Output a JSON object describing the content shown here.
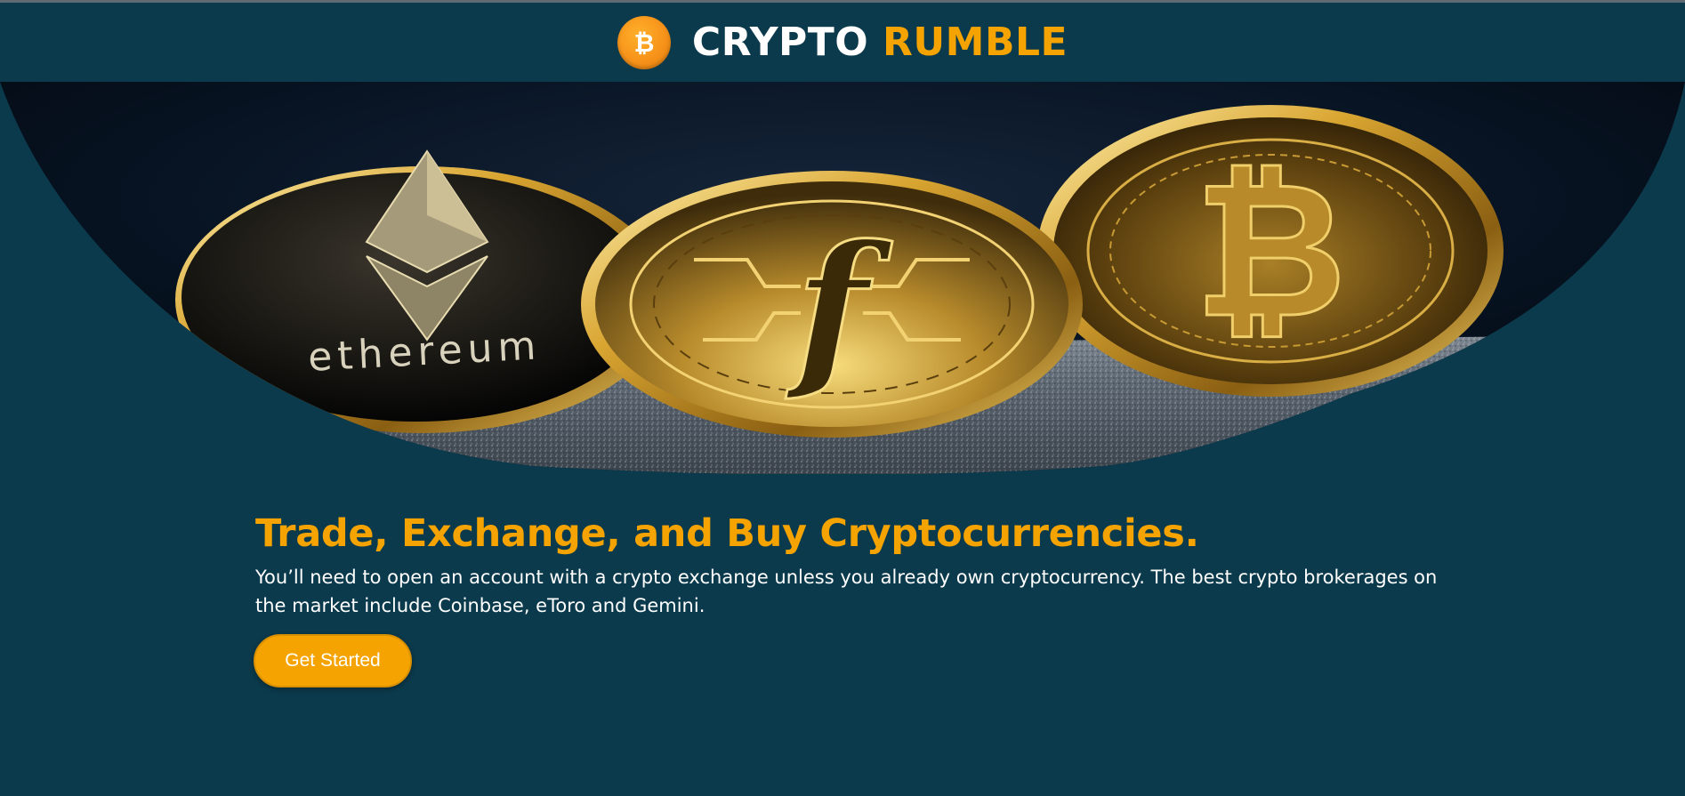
{
  "header": {
    "brand_part1": "CRYPTO ",
    "brand_part2": "RUMBLE",
    "logo_icon": "bitcoin-icon",
    "logo_glyph": "₿"
  },
  "hero": {
    "image": "crypto-coins-photo",
    "coins": [
      "ethereum-coin",
      "filecoin-coin",
      "bitcoin-coin"
    ],
    "coin_text": "ethereum"
  },
  "main": {
    "headline": "Trade, Exchange, and Buy Cryptocurrencies.",
    "body": "You’ll need to open an account with a crypto exchange unless you already own cryptocurrency. The best crypto brokerages on the market include Coinbase, eToro and Gemini.",
    "cta_label": "Get Started"
  },
  "colors": {
    "background": "#0b3a4c",
    "accent": "#f5a300",
    "text": "#ffffff"
  }
}
